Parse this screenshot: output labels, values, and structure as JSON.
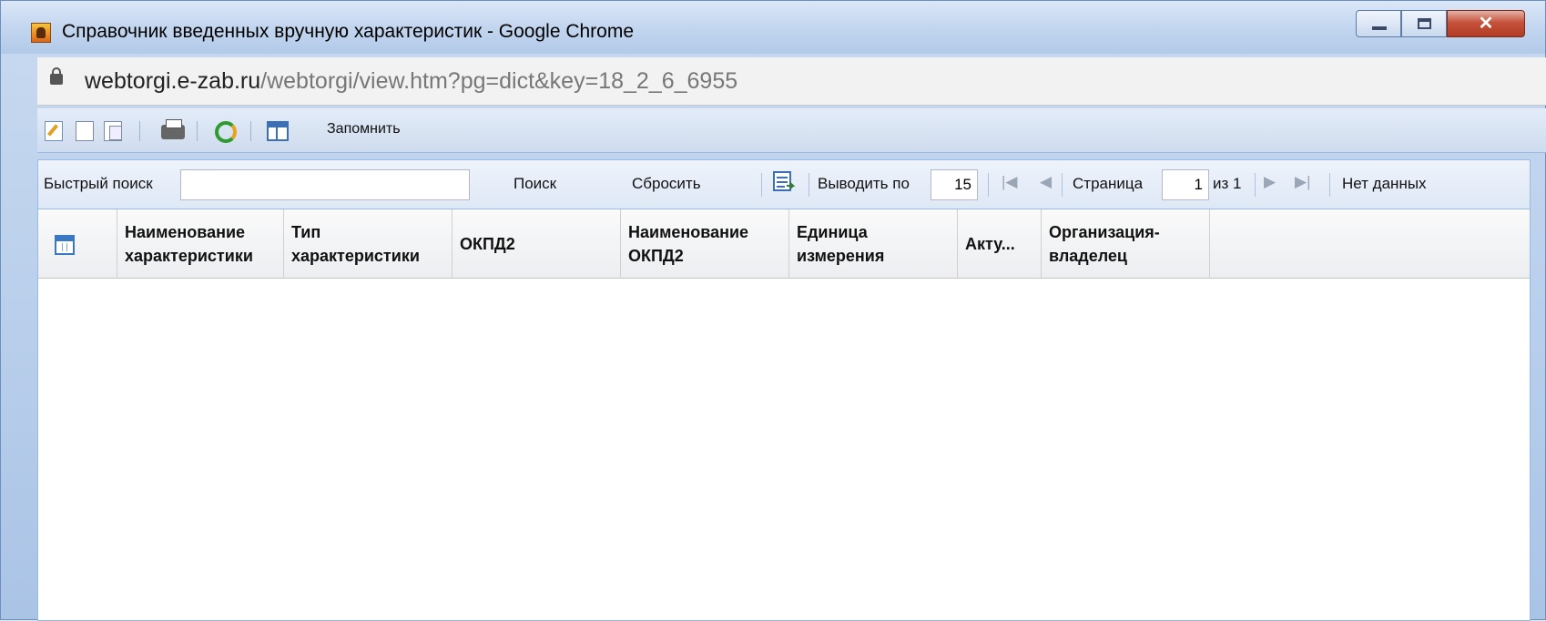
{
  "window": {
    "title": "Справочник введенных вручную характеристик - Google Chrome"
  },
  "address": {
    "host": "webtorgi.e-zab.ru",
    "path": "/webtorgi/view.htm?pg=dict&key=18_2_6_6955"
  },
  "toolbar": {
    "icons": [
      "edit-icon",
      "new-document-icon",
      "copy-icon",
      "print-icon",
      "refresh-icon",
      "columns-icon"
    ],
    "remember_label": "Запомнить"
  },
  "search": {
    "quick_search_label": "Быстрый поиск",
    "query_value": "",
    "search_button": "Поиск",
    "reset_button": "Сбросить",
    "page_size_label": "Выводить по",
    "page_size_value": "15",
    "page_label": "Страница",
    "page_value": "1",
    "page_total": "из 1",
    "status": "Нет данных"
  },
  "grid": {
    "columns": [
      {
        "line1": "Наименование",
        "line2": "характеристики"
      },
      {
        "line1": "Тип",
        "line2": "характеристики"
      },
      {
        "line1": "ОКПД2",
        "line2": ""
      },
      {
        "line1": "Наименование",
        "line2": "ОКПД2"
      },
      {
        "line1": "Единица",
        "line2": "измерения"
      },
      {
        "line1": "Акту...",
        "line2": ""
      },
      {
        "line1": "Организация-",
        "line2": "владелец"
      }
    ],
    "rows": []
  },
  "colors": {
    "frame_blue": "#99bbe8",
    "header_bg": "#dfe8f6"
  }
}
